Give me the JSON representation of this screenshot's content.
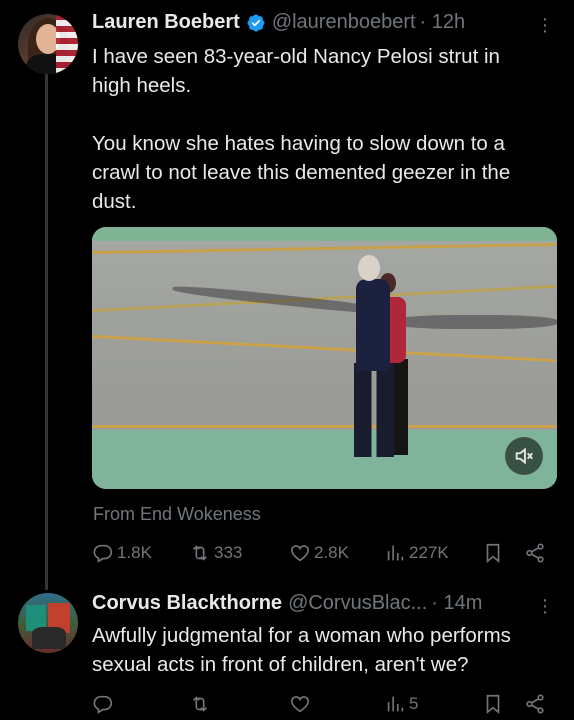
{
  "tweet1": {
    "name": "Lauren Boebert",
    "handle": "@laurenboebert",
    "time": "· 12h",
    "text": "I have seen 83-year-old Nancy Pelosi strut in\nhigh heels.\n\nYou know she hates having to slow down to a\ncrawl to not leave this demented geezer in the\ndust.",
    "source": "From End Wokeness",
    "replies": "1.8K",
    "reposts": "333",
    "likes": "2.8K",
    "views": "227K"
  },
  "tweet2": {
    "name": "Corvus Blackthorne",
    "handle": "@CorvusBlac...",
    "time": "· 14m",
    "text": "Awfully judgmental for a woman who performs\nsexual acts in front of children, aren't we?",
    "replies": "",
    "reposts": "",
    "likes": "",
    "views": "5"
  },
  "colors": {
    "background": "#000000",
    "text": "#e7e9ea",
    "muted": "#71767b",
    "verified": "#1d9bf0",
    "thread_line": "#333639"
  },
  "icons": [
    "verified-badge-icon",
    "more-icon",
    "mute-icon",
    "reply-icon",
    "repost-icon",
    "like-icon",
    "views-icon",
    "bookmark-icon",
    "share-icon"
  ]
}
